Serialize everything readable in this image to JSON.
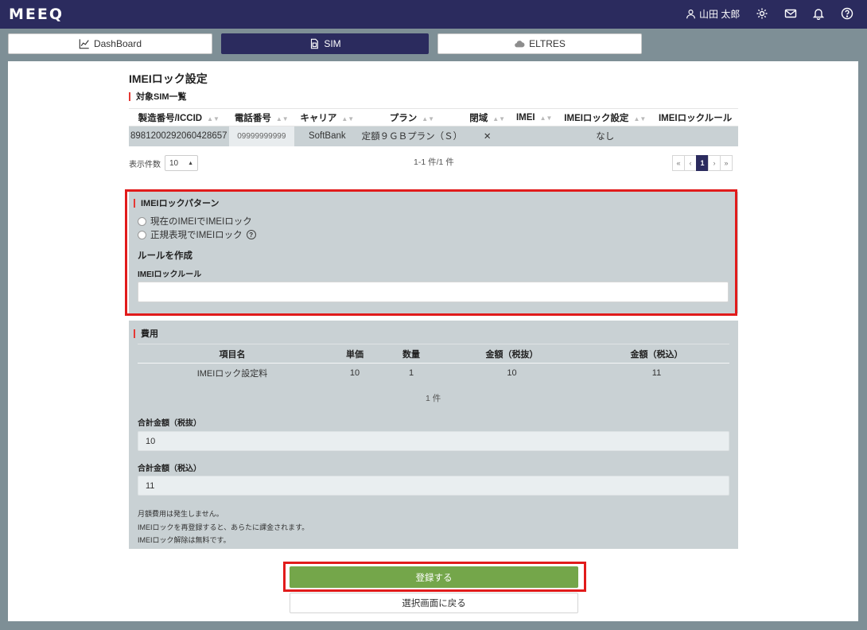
{
  "brand": {
    "logo": "MEEQ"
  },
  "header": {
    "user_name": "山田 太郎"
  },
  "tabs": [
    {
      "label": "DashBoard",
      "icon": "chart-line-icon"
    },
    {
      "label": "SIM",
      "icon": "sim-card-icon"
    },
    {
      "label": "ELTRES",
      "icon": "cloud-icon"
    }
  ],
  "page": {
    "title": "IMEIロック設定"
  },
  "sim_list": {
    "title": "対象SIM一覧",
    "columns": [
      "製造番号/ICCID",
      "電話番号",
      "キャリア",
      "プラン",
      "閉域",
      "IMEI",
      "IMEIロック設定",
      "IMEIロックルール"
    ],
    "rows": [
      {
        "iccid": "8981200292060428657",
        "phone": "09999999999",
        "carrier": "SoftBank",
        "plan": "定額９ＧＢプラン（Ｓ）",
        "closed": "✕",
        "imei": "",
        "lock_setting": "なし",
        "lock_rule": ""
      }
    ],
    "per_page_label": "表示件数",
    "per_page_value": "10",
    "count_text": "1-1 件/1 件",
    "pager": {
      "first": "«",
      "prev": "‹",
      "current": "1",
      "next": "›",
      "last": "»"
    }
  },
  "lock_pattern": {
    "title": "IMEIロックパターン",
    "options": [
      "現在のIMEIでIMEIロック",
      "正規表現でIMEIロック"
    ],
    "help": "?",
    "rule_heading": "ルールを作成",
    "rule_label": "IMEIロックルール",
    "rule_value": ""
  },
  "fees": {
    "title": "費用",
    "columns": [
      "項目名",
      "単価",
      "数量",
      "金額（税抜）",
      "金額（税込）"
    ],
    "rows": [
      {
        "name": "IMEIロック設定料",
        "unit": "10",
        "qty": "1",
        "excl": "10",
        "incl": "11"
      }
    ],
    "count_text": "1 件",
    "total_excl_label": "合計金額（税抜）",
    "total_excl_value": "10",
    "total_incl_label": "合計金額（税込）",
    "total_incl_value": "11",
    "notes": [
      "月額費用は発生しません。",
      "IMEIロックを再登録すると、あらたに課金されます。",
      "IMEIロック解除は無料です。"
    ]
  },
  "actions": {
    "submit": "登録する",
    "back": "選択画面に戻る"
  },
  "colors": {
    "header": "#2b2b5e",
    "highlight": "#e11b1b",
    "primary_button": "#74a64a",
    "section_bg": "#c9d1d4"
  }
}
